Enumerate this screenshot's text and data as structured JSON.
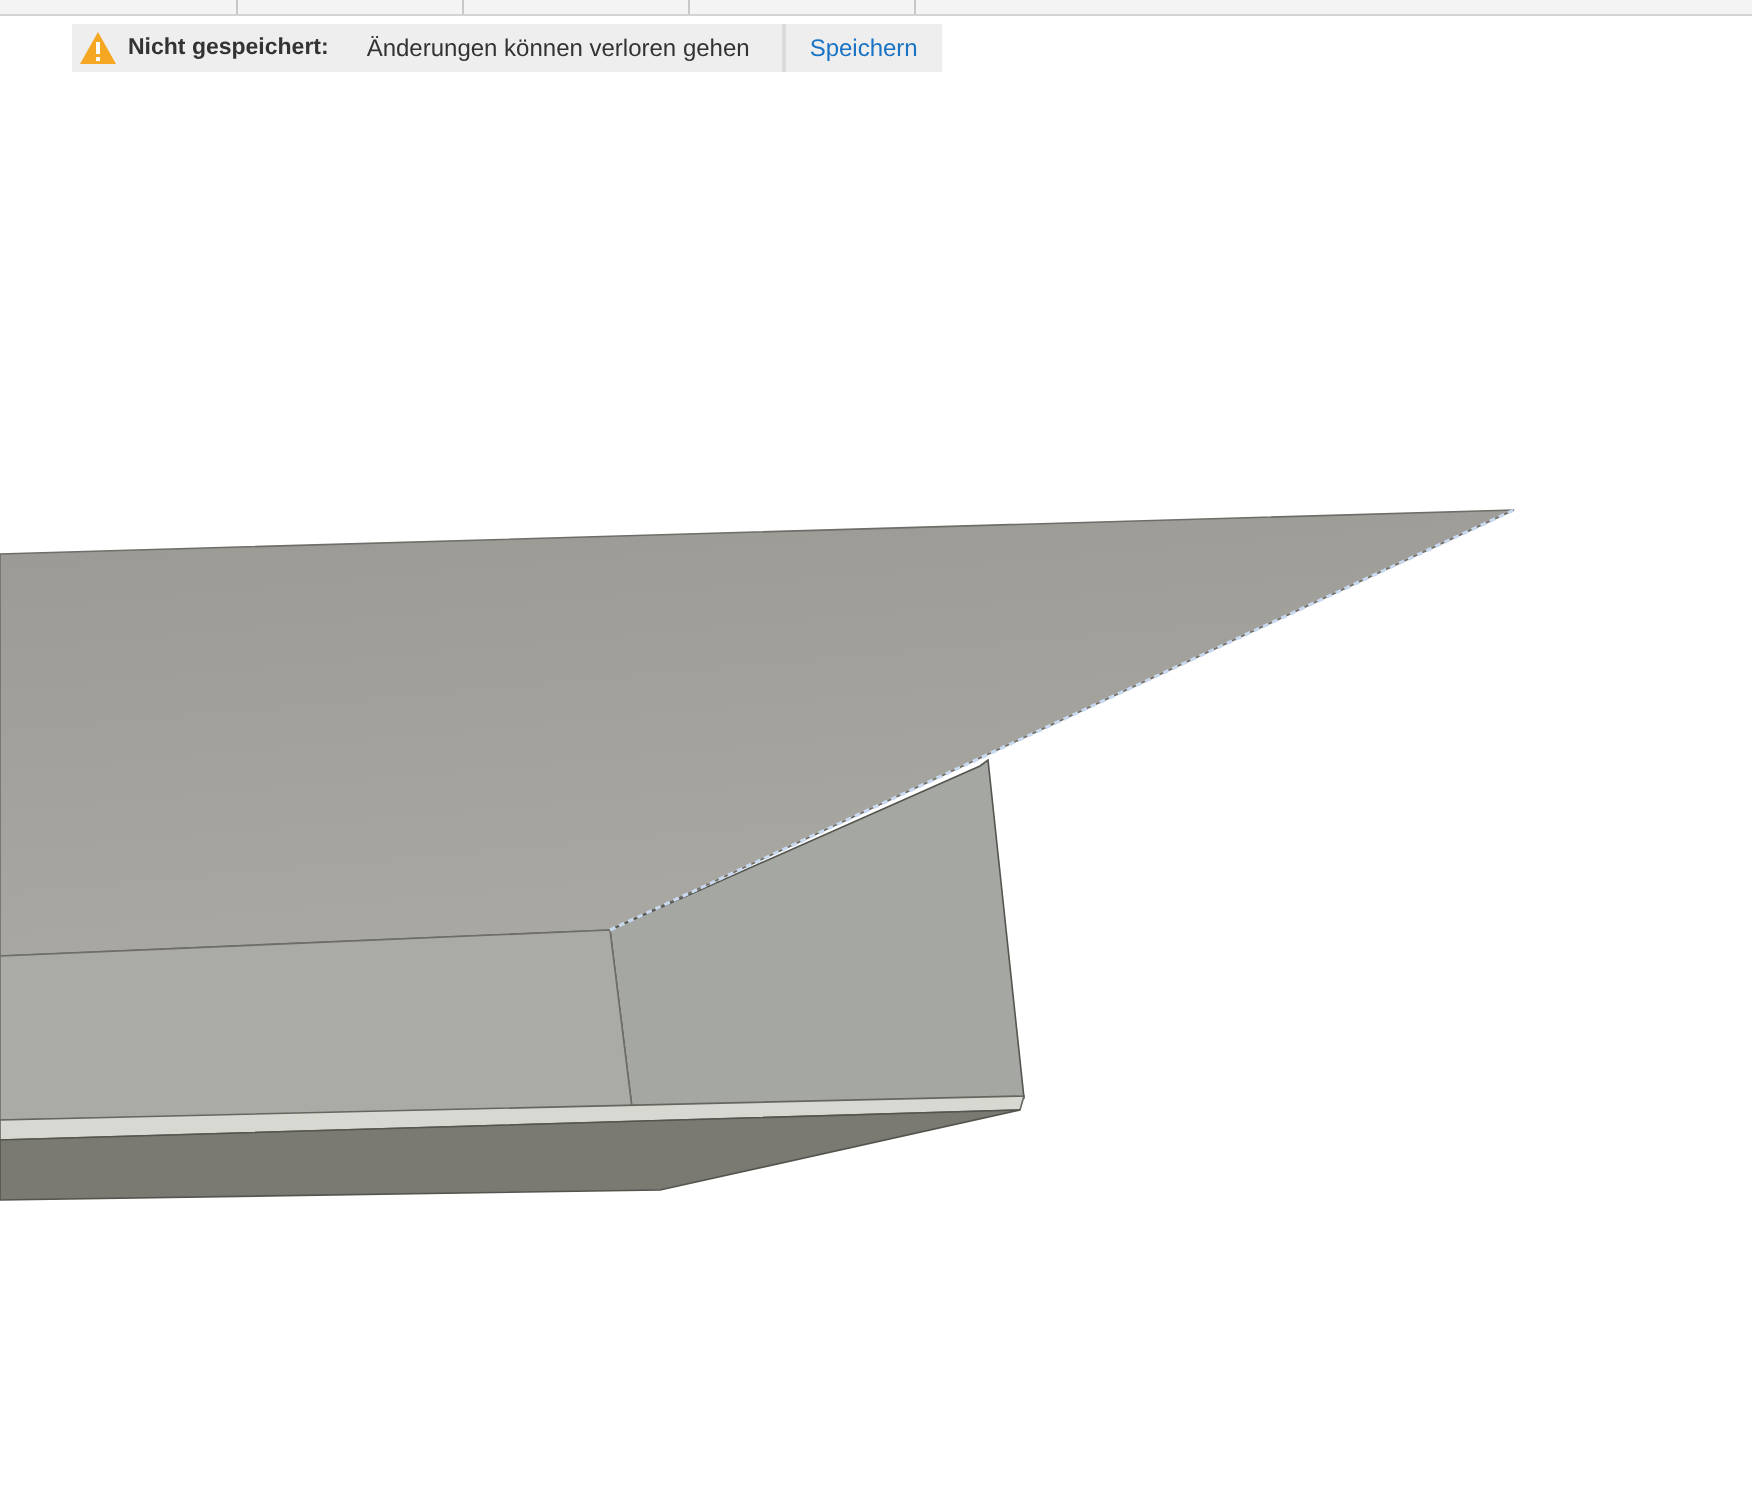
{
  "banner": {
    "title": "Nicht gespeichert:",
    "message": "Änderungen können verloren gehen",
    "action": "Speichern"
  }
}
